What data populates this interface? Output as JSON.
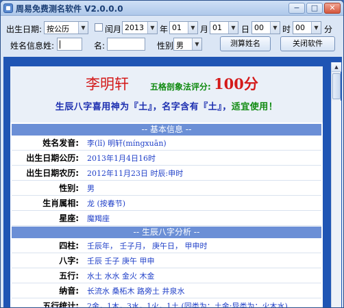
{
  "window": {
    "title": "周易免费测名软件 V2.0.0.0",
    "controls": [
      "−",
      "□",
      "✕"
    ]
  },
  "toolbar": {
    "birth_date_label": "出生日期:",
    "calendar_value": "按公历",
    "leap_month_label": "闰月",
    "year_value": "2013",
    "year_unit": "年",
    "month_value": "01",
    "month_unit": "月",
    "day_value": "01",
    "day_unit": "日",
    "hour_value": "00",
    "hour_unit": "时",
    "minute_value": "00",
    "minute_unit": "分",
    "name_info_label": "姓名信息:",
    "surname_label": "姓:",
    "surname_value": "",
    "given_label": "名:",
    "given_value": "",
    "gender_label": "性别:",
    "gender_value": "男",
    "calc_button": "测算姓名",
    "close_button": "关闭软件"
  },
  "result": {
    "name": "李明轩",
    "score_label": "五格剖象法评分:",
    "score_value": "100分",
    "summary_main": "生辰八字喜用神为『土』，名字含有『土』，",
    "summary_good": "适宜使用！",
    "section_basic": "-- 基本信息 --",
    "basic_rows": [
      {
        "key": "姓名发音:",
        "value": "李(lǐ) 明轩(míngxuān)"
      },
      {
        "key": "出生日期公历:",
        "value": "2013年1月4日16时"
      },
      {
        "key": "出生日期农历:",
        "value": "2012年11月23日 时辰:申时"
      },
      {
        "key": "性别:",
        "value": "男"
      },
      {
        "key": "生肖属相:",
        "value": "龙 (按春节)"
      },
      {
        "key": "星座:",
        "value": "魔羯座"
      }
    ],
    "section_bazi": "-- 生辰八字分析 --",
    "bazi_rows": [
      {
        "key": "四柱:",
        "value": "壬辰年， 壬子月， 庚午日， 甲申时"
      },
      {
        "key": "八字:",
        "value": "壬辰  壬子  庚午  甲申"
      },
      {
        "key": "五行:",
        "value": "水土  水水  金火  木金"
      },
      {
        "key": "纳音:",
        "value": "长流水  桑柘木  路旁土  井泉水"
      },
      {
        "key": "五行统计:",
        "value": "2金，1木，3水，1火，1土  (同类为：土金;异类为：火木水)"
      }
    ]
  },
  "colors": {
    "name_red": "#d41a1a",
    "score_green": "#108a10",
    "summary_blue": "#1c2fb0",
    "section_bg": "#6b8fd6",
    "value_blue": "#2040c8",
    "outer_blue": "#1f55b4"
  }
}
